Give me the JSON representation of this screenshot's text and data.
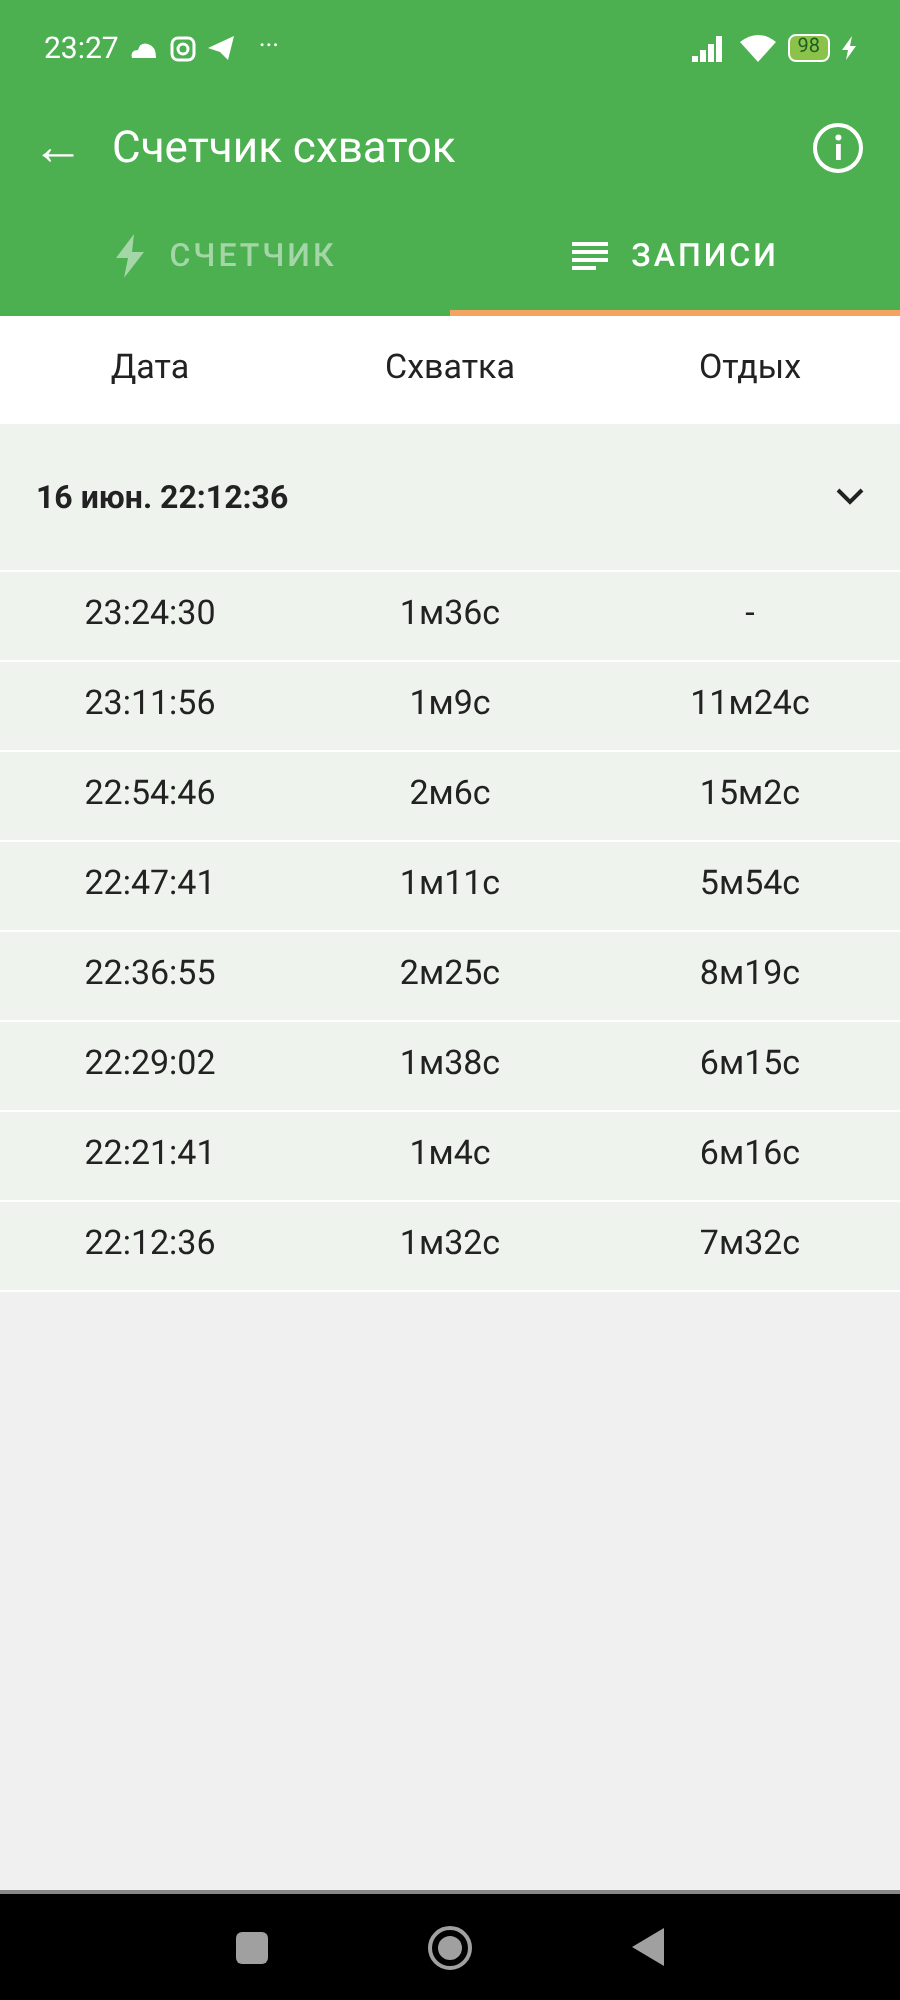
{
  "status_bar": {
    "time": "23:27",
    "more": "···",
    "battery": "98"
  },
  "toolbar": {
    "back": "←",
    "title": "Счетчик схваток"
  },
  "tabs": [
    {
      "label": "СЧЕТЧИК",
      "kind": "counter",
      "selected": false
    },
    {
      "label": "ЗАПИСИ",
      "kind": "records",
      "selected": true
    }
  ],
  "table": {
    "columns": [
      "Дата",
      "Схватка",
      "Отдых"
    ],
    "groups": [
      {
        "title": "16 июн. 22:12:36",
        "expanded": true,
        "rows": [
          [
            "23:24:30",
            "1м36с",
            "-"
          ],
          [
            "23:11:56",
            "1м9с",
            "11м24с"
          ],
          [
            "22:54:46",
            "2м6с",
            "15м2с"
          ],
          [
            "22:47:41",
            "1м11с",
            "5м54с"
          ],
          [
            "22:36:55",
            "2м25с",
            "8м19с"
          ],
          [
            "22:29:02",
            "1м38с",
            "6м15с"
          ],
          [
            "22:21:41",
            "1м4с",
            "6м16с"
          ],
          [
            "22:12:36",
            "1м32с",
            "7м32с"
          ]
        ]
      }
    ]
  }
}
